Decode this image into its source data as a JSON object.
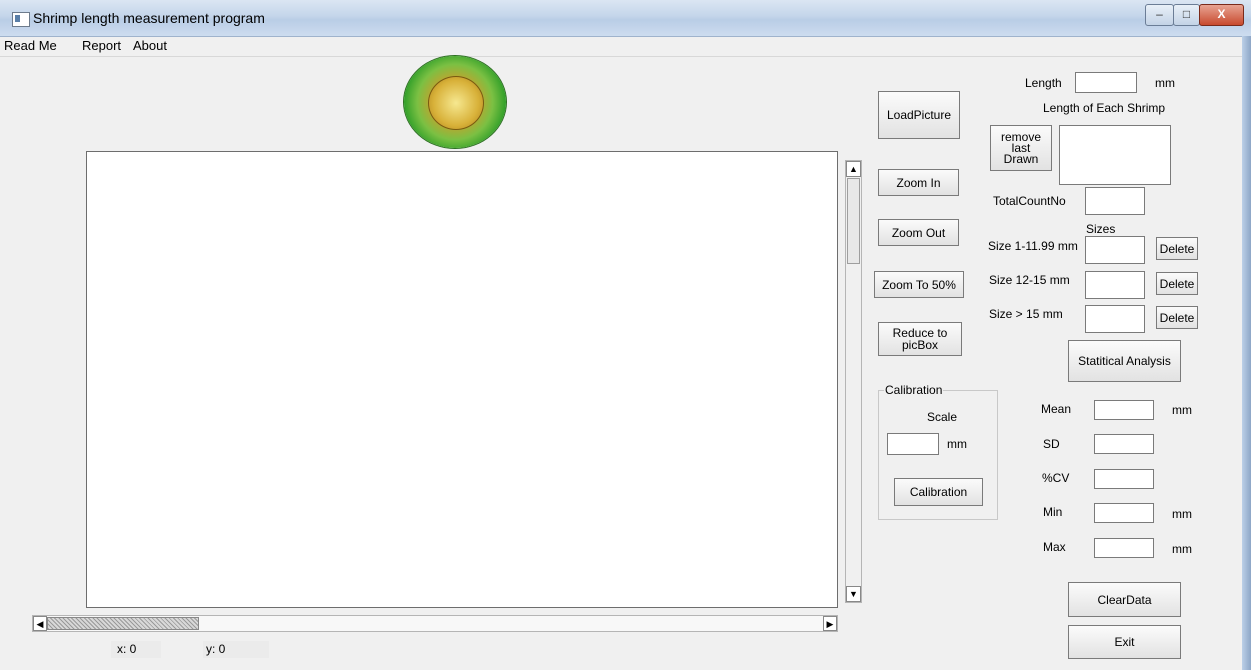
{
  "window": {
    "title": "Shrimp length measurement program",
    "controls": {
      "minimize": "–",
      "maximize": "□",
      "close": "X"
    }
  },
  "menu": {
    "items": [
      "Read Me",
      "Report",
      "About"
    ]
  },
  "toolbar": {
    "load_picture": "LoadPicture",
    "zoom_in": "Zoom In",
    "zoom_out": "Zoom Out",
    "zoom_50": "Zoom To 50%",
    "reduce_1": "Reduce to",
    "reduce_2": "picBox"
  },
  "calibration": {
    "group_label": "Calibration",
    "scale_label": "Scale",
    "scale_value": "",
    "unit": "mm",
    "button": "Calibration"
  },
  "measure": {
    "length_label": "Length",
    "length_value": "",
    "length_unit": "mm",
    "each_label": "Length of Each Shrimp",
    "remove_1": "remove",
    "remove_2": "last",
    "remove_3": "Drawn",
    "total_label": "TotalCountNo",
    "total_value": ""
  },
  "sizes": {
    "heading": "Sizes",
    "rows": [
      {
        "label": "Size 1-11.99 mm",
        "value": "",
        "button": "Delete"
      },
      {
        "label": "Size 12-15 mm",
        "value": "",
        "button": "Delete"
      },
      {
        "label": "Size > 15 mm",
        "value": "",
        "button": "Delete"
      }
    ]
  },
  "stats": {
    "button": "Statitical Analysis",
    "rows": [
      {
        "label": "Mean",
        "value": "",
        "unit": "mm"
      },
      {
        "label": "SD",
        "value": "",
        "unit": ""
      },
      {
        "label": "%CV",
        "value": "",
        "unit": ""
      },
      {
        "label": "Min",
        "value": "",
        "unit": "mm"
      },
      {
        "label": "Max",
        "value": "",
        "unit": "mm"
      }
    ]
  },
  "actions": {
    "clear": "ClearData",
    "exit": "Exit"
  },
  "status": {
    "x_label": "x: 0",
    "y_label": "y: 0"
  },
  "colors": {
    "titlebar": "#c4d5ea",
    "close_button": "#c84a2e",
    "logo_green": "#2e9e28",
    "logo_gold": "#d8b139"
  },
  "icons": [
    "app-window-icon",
    "university-seal-logo",
    "scroll-up-arrow",
    "scroll-down-arrow",
    "scroll-left-arrow",
    "scroll-right-arrow"
  ]
}
